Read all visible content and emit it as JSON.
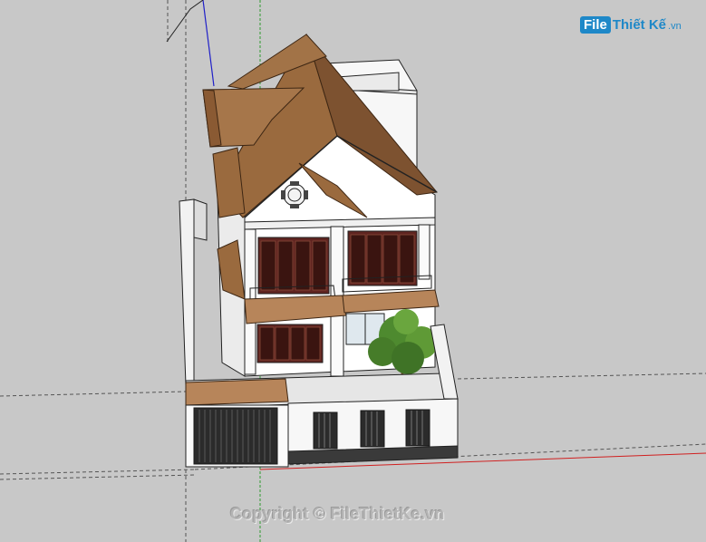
{
  "watermark": {
    "logo_file": "File",
    "logo_rest": "Thiết Kế",
    "logo_tld": ".vn",
    "copyright": "Copyright © FileThietKe.vn"
  },
  "colors": {
    "background": "#c8c8c8",
    "roof": "#9a6a3e",
    "roof_dark": "#7a4f2c",
    "wall": "#ffffff",
    "door": "#6b2a22",
    "axis_red": "#d02020",
    "axis_green": "#2f9a2f",
    "axis_blue": "#2020c8"
  }
}
